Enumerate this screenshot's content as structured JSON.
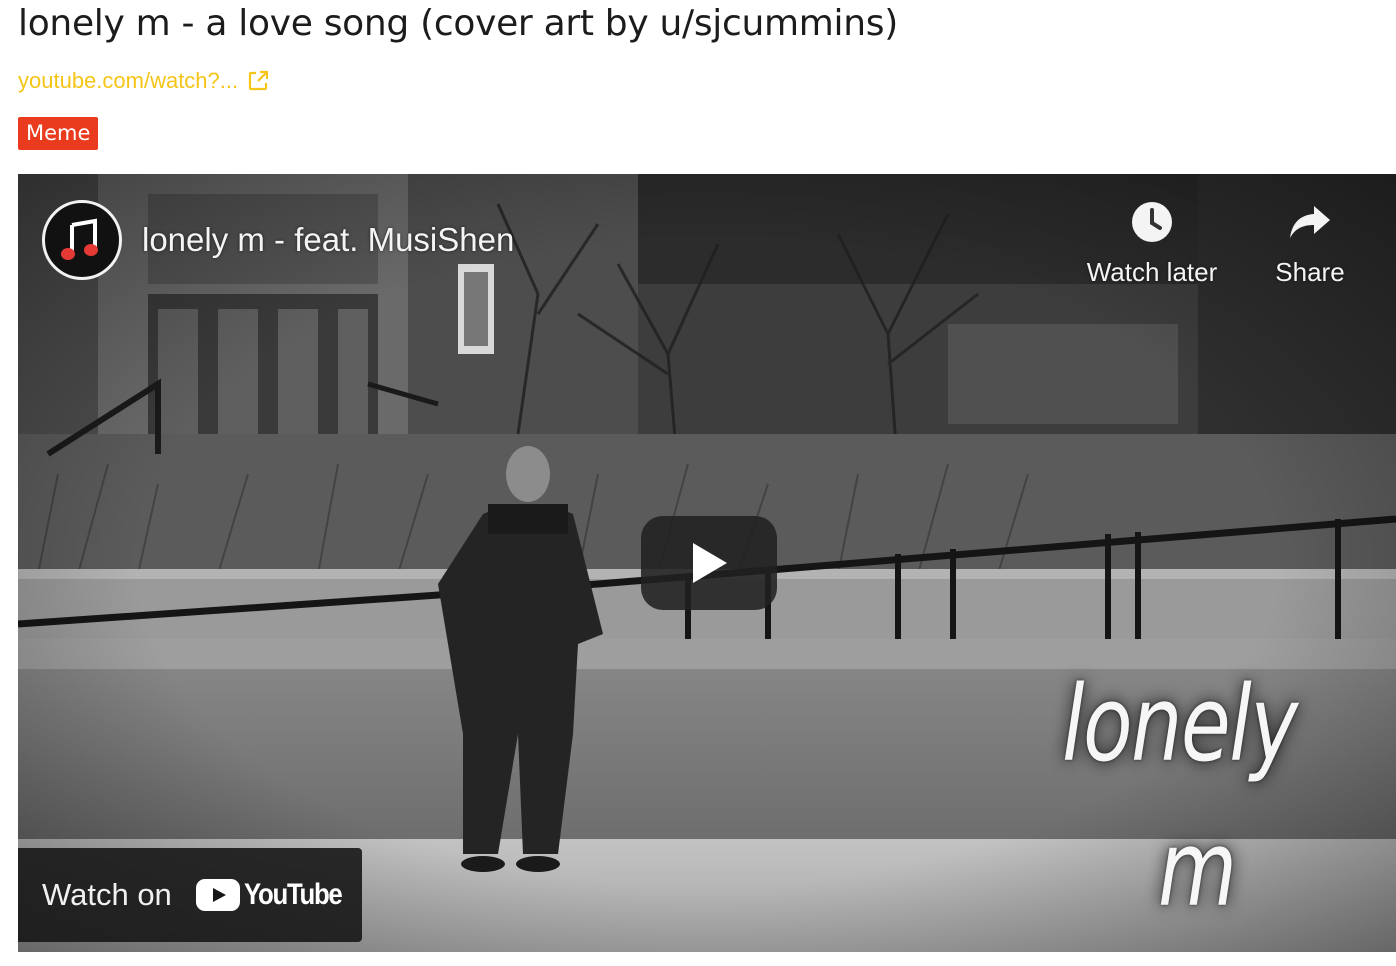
{
  "post": {
    "title": "lonely m - a love song (cover art by u/sjcummins)",
    "link_text": "youtube.com/watch?...",
    "flair": "Meme",
    "flair_color": "#ea3b1e",
    "link_color": "#f5c518"
  },
  "embed": {
    "video_title": "lonely m - feat. MusiShen",
    "channel_icon": "music-note-icon",
    "actions": {
      "watch_later_label": "Watch later",
      "watch_later_icon": "clock-icon",
      "share_label": "Share",
      "share_icon": "share-arrow-icon"
    },
    "play_icon": "play-icon",
    "watch_on_label": "Watch on",
    "youtube_wordmark": "YouTube",
    "overlay_line1": "lonely",
    "overlay_line2": "m"
  }
}
